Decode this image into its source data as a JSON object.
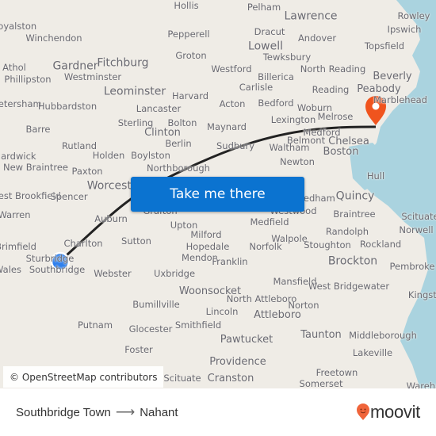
{
  "route": {
    "origin": "Southbridge Town",
    "destination": "Nahant",
    "arrow_icon": "arrow-right-icon"
  },
  "cta": {
    "label": "Take me there"
  },
  "attribution": "© OpenStreetMap contributors",
  "brand": {
    "name": "moovit",
    "color": "#f0643a"
  },
  "colors": {
    "route_line": "#222222",
    "origin_marker": "#2f80ed",
    "destination_marker": "#f0541e",
    "button": "#0b73d0",
    "water": "#aad3df"
  },
  "places": [
    {
      "name": "Hollis"
    },
    {
      "name": "Pelham"
    },
    {
      "name": "Lawrence"
    },
    {
      "name": "Rowley"
    },
    {
      "name": "Royalston"
    },
    {
      "name": "Winchendon"
    },
    {
      "name": "Pepperell"
    },
    {
      "name": "Dracut"
    },
    {
      "name": "Andover"
    },
    {
      "name": "Ipswich"
    },
    {
      "name": "Topsfield"
    },
    {
      "name": "Groton"
    },
    {
      "name": "Lowell"
    },
    {
      "name": "Tewksbury"
    },
    {
      "name": "Athol"
    },
    {
      "name": "Gardner"
    },
    {
      "name": "Fitchburg"
    },
    {
      "name": "Westminster"
    },
    {
      "name": "Westford"
    },
    {
      "name": "North Reading"
    },
    {
      "name": "Beverly"
    },
    {
      "name": "Phillipston"
    },
    {
      "name": "Billerica"
    },
    {
      "name": "Leominster"
    },
    {
      "name": "Peabody"
    },
    {
      "name": "Carlisle"
    },
    {
      "name": "Reading"
    },
    {
      "name": "Marblehead"
    },
    {
      "name": "Petersham"
    },
    {
      "name": "Hubbardston"
    },
    {
      "name": "Harvard"
    },
    {
      "name": "Acton"
    },
    {
      "name": "Bedford"
    },
    {
      "name": "Woburn"
    },
    {
      "name": "Lancaster"
    },
    {
      "name": "Lexington"
    },
    {
      "name": "Melrose"
    },
    {
      "name": "Sterling"
    },
    {
      "name": "Bolton"
    },
    {
      "name": "Maynard"
    },
    {
      "name": "Medford"
    },
    {
      "name": "Barre"
    },
    {
      "name": "Clinton"
    },
    {
      "name": "Chelsea"
    },
    {
      "name": "Belmont"
    },
    {
      "name": "Rutland"
    },
    {
      "name": "Berlin"
    },
    {
      "name": "Sudbury"
    },
    {
      "name": "Waltham"
    },
    {
      "name": "Boston"
    },
    {
      "name": "Hardwick"
    },
    {
      "name": "Holden"
    },
    {
      "name": "Boylston"
    },
    {
      "name": "Newton"
    },
    {
      "name": "New Braintree"
    },
    {
      "name": "Paxton"
    },
    {
      "name": "Northborough"
    },
    {
      "name": "Hull"
    },
    {
      "name": "Worcester"
    },
    {
      "name": "Needham"
    },
    {
      "name": "Quincy"
    },
    {
      "name": "West Brookfield"
    },
    {
      "name": "Spencer"
    },
    {
      "name": "Westwood"
    },
    {
      "name": "Braintree"
    },
    {
      "name": "Warren"
    },
    {
      "name": "Auburn"
    },
    {
      "name": "Grafton"
    },
    {
      "name": "Scituate"
    },
    {
      "name": "Medfield"
    },
    {
      "name": "Randolph"
    },
    {
      "name": "Norwell"
    },
    {
      "name": "Brimfield"
    },
    {
      "name": "Charlton"
    },
    {
      "name": "Sutton"
    },
    {
      "name": "Upton"
    },
    {
      "name": "Rockland"
    },
    {
      "name": "Walpole"
    },
    {
      "name": "Milford"
    },
    {
      "name": "Sturbridge"
    },
    {
      "name": "Hopedale"
    },
    {
      "name": "Norfolk"
    },
    {
      "name": "Stoughton"
    },
    {
      "name": "Pembroke"
    },
    {
      "name": "Southbridge"
    },
    {
      "name": "Mendon"
    },
    {
      "name": "Franklin"
    },
    {
      "name": "Brockton"
    },
    {
      "name": "Wales"
    },
    {
      "name": "Webster"
    },
    {
      "name": "Uxbridge"
    },
    {
      "name": "Mansfield"
    },
    {
      "name": "West Bridgewater"
    },
    {
      "name": "Kingston"
    },
    {
      "name": "Woonsocket"
    },
    {
      "name": "North Attleboro"
    },
    {
      "name": "Norton"
    },
    {
      "name": "Bumillville"
    },
    {
      "name": "Attleboro"
    },
    {
      "name": "Lincoln"
    },
    {
      "name": "Putnam"
    },
    {
      "name": "Glocester"
    },
    {
      "name": "Smithfield"
    },
    {
      "name": "Taunton"
    },
    {
      "name": "Middleborough"
    },
    {
      "name": "Pawtucket"
    },
    {
      "name": "Foster"
    },
    {
      "name": "Lakeville"
    },
    {
      "name": "Providence"
    },
    {
      "name": "Freetown"
    },
    {
      "name": "Scituate"
    },
    {
      "name": "Cranston"
    },
    {
      "name": "Somerset"
    },
    {
      "name": "Wareham"
    }
  ]
}
